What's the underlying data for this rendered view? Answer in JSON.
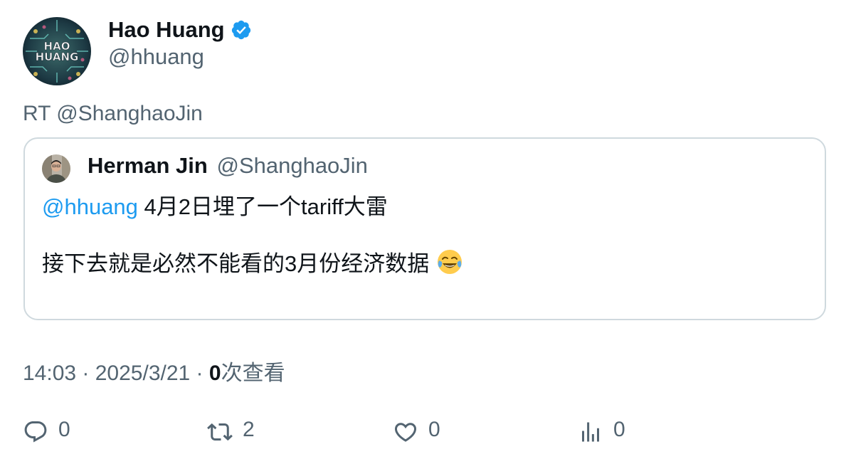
{
  "author": {
    "name": "Hao Huang",
    "handle": "@hhuang",
    "avatar_text_line1": "HAO",
    "avatar_text_line2": "HUANG",
    "verified_icon": "verified-badge-icon"
  },
  "retweet_prefix": "RT @ShanghaoJin",
  "quoted": {
    "name": "Herman Jin",
    "handle": "@ShanghaoJin",
    "mention": "@hhuang",
    "line1_rest": " 4月2日埋了一个tariff大雷",
    "line2": "接下去就是必然不能看的3月份经济数据",
    "emoji": "face-with-tears-of-joy-icon"
  },
  "meta": {
    "time": "14:03",
    "sep1": " · ",
    "date": "2025/3/21",
    "sep2": " · ",
    "views_count": "0",
    "views_label": "次查看"
  },
  "actions": {
    "reply_count": "0",
    "retweet_count": "2",
    "like_count": "0",
    "views_count": "0"
  },
  "colors": {
    "accent": "#1d9bf0",
    "muted": "#536471",
    "text": "#0f1419",
    "border": "#cfd9de"
  }
}
